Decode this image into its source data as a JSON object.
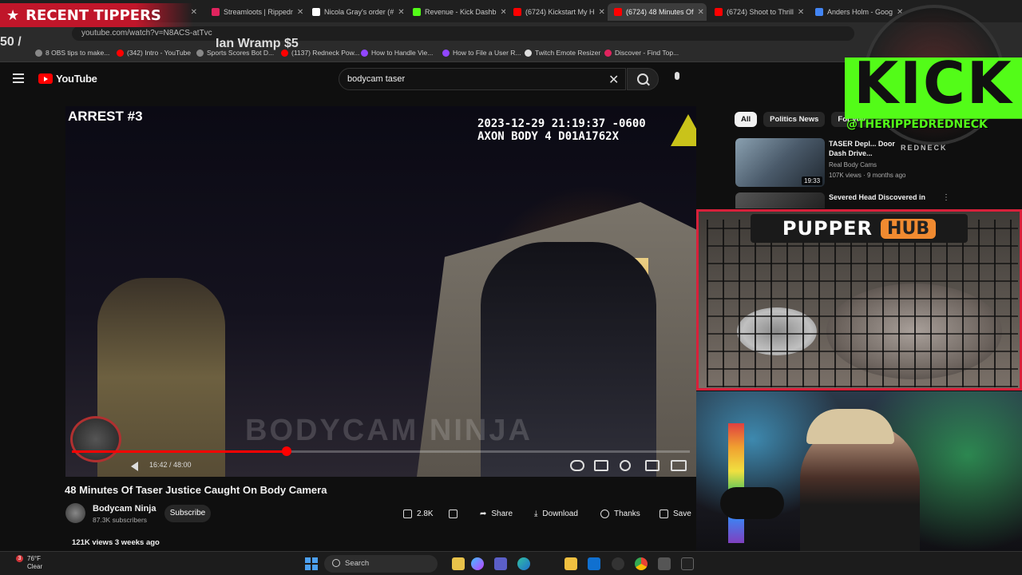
{
  "browser": {
    "tabs": [
      {
        "label": "",
        "color": "#c0162a"
      },
      {
        "label": "Streamloots | Rippedr",
        "color": "#e0245e"
      },
      {
        "label": "Nicola Gray's order (#",
        "color": "#ffffff"
      },
      {
        "label": "Revenue - Kick Dashb",
        "color": "#53fc18"
      },
      {
        "label": "(6724) Kickstart My H",
        "color": "#ff0000"
      },
      {
        "label": "(6724) 48 Minutes Of",
        "color": "#ff0000"
      },
      {
        "label": "(6724) Shoot to Thrill",
        "color": "#ff0000"
      },
      {
        "label": "Anders Holm - Goog",
        "color": "#4285f4"
      }
    ],
    "active_tab_index": 5,
    "url": "youtube.com/watch?v=N8ACS-atTvc",
    "bookmarks": [
      {
        "label": "8 OBS tips to make...",
        "color": "#888888"
      },
      {
        "label": "(342) Intro - YouTube",
        "color": "#ff0000"
      },
      {
        "label": "Sports Scores Bot D...",
        "color": "#888888"
      },
      {
        "label": "(1137) Redneck Pow...",
        "color": "#ff0000"
      },
      {
        "label": "How to Handle Vie...",
        "color": "#9146ff"
      },
      {
        "label": "How to File a User R...",
        "color": "#9146ff"
      },
      {
        "label": "Twitch Emote Resizer",
        "color": "#dddddd"
      },
      {
        "label": "Discover - Find Top...",
        "color": "#e0245e"
      }
    ]
  },
  "overlay": {
    "recent_tippers": "RECENT TIPPERS",
    "ticker_left": "50 /",
    "ticker_right": "Ian Wramp $5",
    "kick_word": "KICK",
    "kick_handle": "@THERIPPEDREDNECK",
    "kick_emblem_text": "REDNECK",
    "pupper_word": "PUPPER",
    "hub_word": "HUB"
  },
  "youtube": {
    "logo_text": "YouTube",
    "search_query": "bodycam taser",
    "video": {
      "label_arrest": "ARREST #3",
      "stamp_line1": "2023-12-29 21:19:37 -0600",
      "stamp_line2": "AXON BODY 4 D01A1762X",
      "watermark": "BODYCAM NINJA",
      "time": "16:42 / 48:00",
      "progress": 0.348
    },
    "title": "48 Minutes Of Taser Justice Caught On Body Camera",
    "channel": {
      "name": "Bodycam Ninja",
      "subscribers": "87.3K subscribers"
    },
    "subscribe_label": "Subscribe",
    "actions": {
      "likes": "2.8K",
      "share": "Share",
      "download": "Download",
      "thanks": "Thanks",
      "save": "Save"
    },
    "views_line": "121K views  3 weeks ago",
    "chips": [
      "All",
      "Politics News",
      "For you"
    ],
    "recommendations": [
      {
        "title": "TASER Depl... Door Dash Drive...",
        "channel": "Real Body Cams",
        "meta": "107K views · 9 months ago",
        "duration": "19:33"
      },
      {
        "title": "Severed Head Discovered in",
        "channel": "",
        "meta": "",
        "duration": ""
      }
    ]
  },
  "taskbar": {
    "weather_temp": "76°F",
    "weather_desc": "Clear",
    "notif_count": "3",
    "search_label": "Search"
  }
}
